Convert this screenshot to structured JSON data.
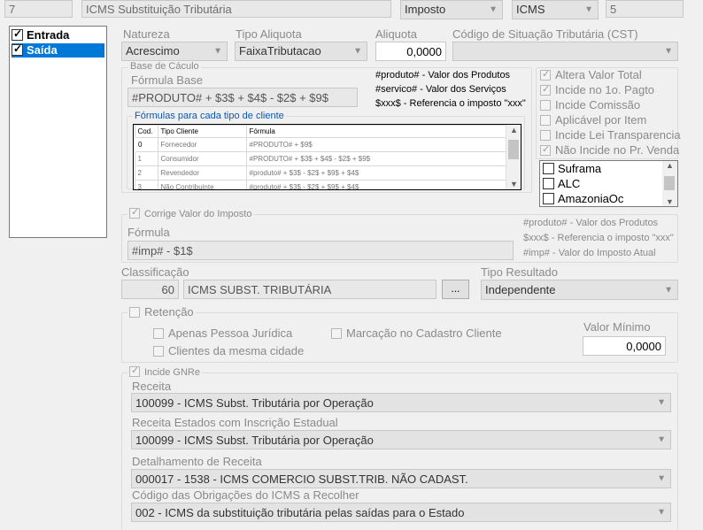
{
  "top": {
    "code": "7",
    "description": "ICMS Substituição Tributária",
    "type": "Imposto",
    "tax": "ICMS",
    "number": "5"
  },
  "direction": {
    "items": [
      {
        "label": "Entrada",
        "checked": true,
        "selected": false
      },
      {
        "label": "Saída",
        "checked": true,
        "selected": true
      }
    ]
  },
  "natureza": {
    "label": "Natureza",
    "value": "Acrescimo"
  },
  "tipo_aliquota": {
    "label": "Tipo Aliquota",
    "value": "FaixaTributacao"
  },
  "aliquota": {
    "label": "Aliquota",
    "value": "0,0000"
  },
  "cst": {
    "label": "Código de Situação Tributária (CST)",
    "value": ""
  },
  "base_calculo": {
    "title": "Base de Cáculo",
    "formula_label": "Fórmula Base",
    "formula": "#PRODUTO# + $3$ + $4$ - $2$ + $9$",
    "legend": [
      "#produto# - Valor dos Produtos",
      "#servico# - Valor dos Serviços",
      "$xxx$ - Referencia o imposto \"xxx\""
    ],
    "client_formulas_title": "Fórmulas para cada tipo de cliente",
    "grid": {
      "headers": [
        "Cod.",
        "Tipo Cliente",
        "Fórmula"
      ],
      "rows": [
        [
          "0",
          "Fornecedor",
          "#PRODUTO# + $9$"
        ],
        [
          "1",
          "Consumidor",
          "#PRODUTO# + $3$ + $4$ - $2$ + $9$"
        ],
        [
          "2",
          "Revendedor",
          "#produto# + $3$ - $2$ + $9$ + $4$"
        ],
        [
          "3",
          "Não Contribuinte",
          "#produto# + $3$ - $2$ + $9$ + $4$"
        ]
      ]
    }
  },
  "options": [
    {
      "label": "Altera Valor Total",
      "checked": true
    },
    {
      "label": "Incide no 1o. Pagto",
      "checked": true
    },
    {
      "label": "Incide Comissão",
      "checked": false
    },
    {
      "label": "Aplicável por Item",
      "checked": false
    },
    {
      "label": "Incide Lei Transparencia",
      "checked": false
    },
    {
      "label": "Não Incide no Pr. Venda",
      "checked": true
    }
  ],
  "regions": [
    {
      "label": "Suframa",
      "checked": false
    },
    {
      "label": "ALC",
      "checked": false
    },
    {
      "label": "AmazoniaOc",
      "checked": false
    }
  ],
  "corrige": {
    "label": "Corrige Valor do Imposto",
    "checked": true,
    "formula_label": "Fórmula",
    "formula": "#imp# - $1$",
    "legend": [
      "#produto# - Valor dos Produtos",
      "$xxx$ - Referencia o imposto \"xxx\"",
      "#imp# - Valor do Imposto Atual"
    ]
  },
  "classificacao": {
    "label": "Classificação",
    "code": "60",
    "description": "ICMS SUBST. TRIBUTÁRIA",
    "button": "..."
  },
  "tipo_resultado": {
    "label": "Tipo Resultado",
    "value": "Independente"
  },
  "retencao": {
    "label": "Retenção",
    "checked": false,
    "opt1": "Apenas Pessoa Jurídica",
    "opt2": "Clientes da mesma cidade",
    "opt3": "Marcação no Cadastro Cliente",
    "valor_minimo_label": "Valor Mínimo",
    "valor_minimo": "0,0000"
  },
  "gnre": {
    "label": "Incide GNRe",
    "checked": true,
    "receita_label": "Receita",
    "receita": "100099 - ICMS Subst. Tributária por Operação",
    "receita_ie_label": "Receita Estados com Inscrição Estadual",
    "receita_ie": "100099 - ICMS Subst. Tributária por Operação",
    "detalhamento_label": "Detalhamento de Receita",
    "detalhamento": "000017 - 1538 - ICMS COMERCIO SUBST.TRIB. NÃO CADAST.",
    "obrigacoes_label": "Código das Obrigações do ICMS a Recolher",
    "obrigacoes": "002 - ICMS da substituição tributária pelas saídas para o Estado"
  },
  "icons": {
    "dropdown": "chevron-down-icon",
    "scroll_up": "scroll-up-icon",
    "scroll_down": "scroll-down-icon"
  }
}
